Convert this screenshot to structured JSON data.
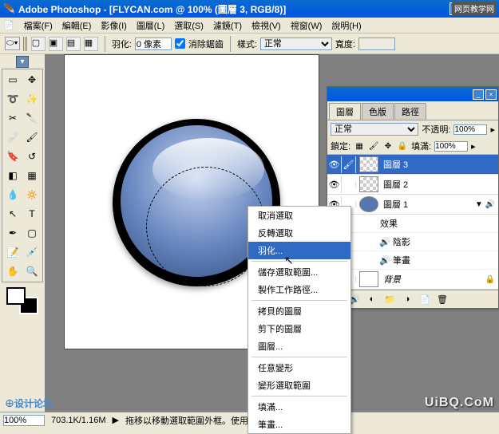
{
  "app": {
    "title": "Adobe Photoshop - [FLYCAN.com @ 100% (圖層 3, RGB/8)]",
    "wm_top": "网页教学网"
  },
  "menu": {
    "items": [
      "檔案(F)",
      "編輯(E)",
      "影像(I)",
      "圖層(L)",
      "選取(S)",
      "濾鏡(T)",
      "檢視(V)",
      "視窗(W)",
      "說明(H)"
    ]
  },
  "options": {
    "feather_label": "羽化:",
    "feather_value": "0 像素",
    "antialias": "消除鋸齒",
    "style_label": "樣式:",
    "style_value": "正常",
    "width_label": "寬度:",
    "width_value": ""
  },
  "tool_tab": "▾",
  "ctx": {
    "items": [
      {
        "label": "取消選取",
        "sel": false
      },
      {
        "label": "反轉選取",
        "sel": false
      },
      {
        "label": "羽化...",
        "sel": true
      },
      {
        "sep": true
      },
      {
        "label": "儲存選取範圍...",
        "sel": false
      },
      {
        "label": "製作工作路徑...",
        "sel": false
      },
      {
        "sep": true
      },
      {
        "label": "拷貝的圖層",
        "sel": false
      },
      {
        "label": "剪下的圖層",
        "sel": false
      },
      {
        "label": "圖層...",
        "sel": false
      },
      {
        "sep": true
      },
      {
        "label": "任意變形",
        "sel": false
      },
      {
        "label": "變形選取範圍",
        "sel": false
      },
      {
        "sep": true
      },
      {
        "label": "填滿...",
        "sel": false
      },
      {
        "label": "筆畫...",
        "sel": false
      }
    ]
  },
  "layers": {
    "tabs": [
      "圖層",
      "色版",
      "路徑"
    ],
    "blend": "正常",
    "opacity_label": "不透明:",
    "opacity_value": "100%",
    "lock_label": "鎖定:",
    "fill_label": "填滿:",
    "fill_value": "100%",
    "rows": [
      {
        "name": "圖層 3",
        "sel": true,
        "thumb": "checker"
      },
      {
        "name": "圖層 2",
        "sel": false,
        "thumb": "checker"
      },
      {
        "name": "圖層 1",
        "sel": false,
        "thumb": "solid",
        "fx": true
      }
    ],
    "effects_label": "效果",
    "subeffects": [
      "陰影",
      "筆畫"
    ],
    "bg_layer": "背景"
  },
  "status": {
    "zoom": "100%",
    "docsize": "703.1K/1.16M",
    "hint": "拖移以移動選取範圍外框。使用 Shift、"
  },
  "watermark": "UiBQ.CoM",
  "watermark_left": "⊕设计论坛"
}
